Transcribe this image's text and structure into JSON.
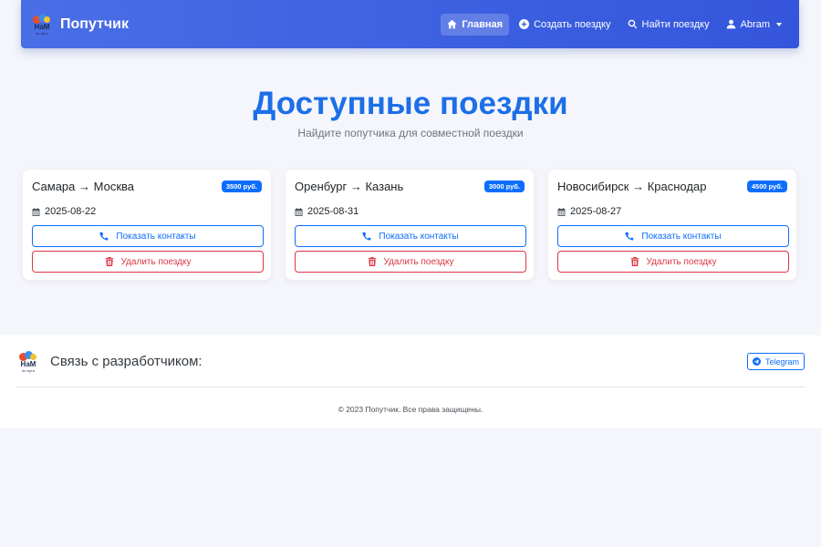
{
  "navbar": {
    "logo_text_top": "НаМ",
    "logo_text_bottom": "по пути",
    "brand": "Попутчик",
    "items": [
      {
        "label": "Главная",
        "icon": "home-icon",
        "active": true
      },
      {
        "label": "Создать поездку",
        "icon": "plus-circle-icon",
        "active": false
      },
      {
        "label": "Найти поездку",
        "icon": "search-icon",
        "active": false
      },
      {
        "label": "Abram",
        "icon": "user-icon",
        "active": false
      }
    ]
  },
  "main": {
    "title": "Доступные поездки",
    "subtitle": "Найдите попутчика для совместной поездки",
    "trips": [
      {
        "route": "Самара → Москва",
        "price": "3500 руб.",
        "date": "2025-08-22",
        "contacts_label": "Показать контакты",
        "delete_label": "Удалить поездку"
      },
      {
        "route": "Оренбург → Казань",
        "price": "3000 руб.",
        "date": "2025-08-31",
        "contacts_label": "Показать контакты",
        "delete_label": "Удалить поездку"
      },
      {
        "route": "Новосибирск → Краснодар",
        "price": "4500 руб.",
        "date": "2025-08-27",
        "contacts_label": "Показать контакты",
        "delete_label": "Удалить поездку"
      }
    ]
  },
  "footer": {
    "contact_label": "Связь с разработчиком:",
    "telegram_label": "Telegram",
    "copyright": "© 2023 Попутчик. Все права защищены."
  },
  "colors": {
    "navbar": "#3b5fe0",
    "accent": "#0d6efd",
    "danger": "#dc3545",
    "title": "#1c6fe8"
  }
}
